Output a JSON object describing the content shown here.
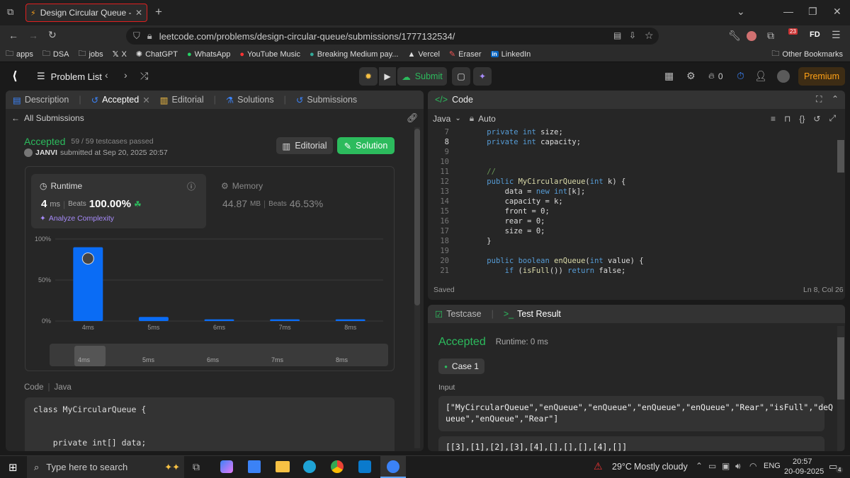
{
  "browser": {
    "tab_title": "Design Circular Queue - LeetCo",
    "url": "leetcode.com/problems/design-circular-queue/submissions/1777132534/",
    "bookmarks": [
      "apps",
      "DSA",
      "jobs",
      "X",
      "ChatGPT",
      "WhatsApp",
      "YouTube Music",
      "Breaking Medium pay...",
      "Vercel",
      "Eraser",
      "LinkedIn"
    ],
    "other_bookmarks": "Other Bookmarks",
    "ext_badge": "23",
    "profile": "FD"
  },
  "header": {
    "problem_list": "Problem List",
    "submit": "Submit",
    "streak": "0",
    "premium": "Premium"
  },
  "left_tabs": {
    "description": "Description",
    "accepted": "Accepted",
    "editorial": "Editorial",
    "solutions": "Solutions",
    "submissions": "Submissions"
  },
  "submission": {
    "back": "All Submissions",
    "status": "Accepted",
    "passed": "59 / 59 testcases passed",
    "user": "JANVI",
    "submitted": "submitted at Sep 20, 2025 20:57",
    "editorial_btn": "Editorial",
    "solution_btn": "Solution",
    "runtime_label": "Runtime",
    "runtime_value": "4",
    "runtime_unit": "ms",
    "beats": "Beats",
    "runtime_beats": "100.00%",
    "analyze": "Analyze Complexity",
    "memory_label": "Memory",
    "memory_value": "44.87",
    "memory_unit": "MB",
    "memory_beats": "46.53%",
    "code_label": "Code",
    "code_lang": "Java"
  },
  "chart_data": {
    "type": "bar",
    "categories": [
      "4ms",
      "5ms",
      "6ms",
      "7ms",
      "8ms"
    ],
    "values": [
      90,
      5,
      2,
      2,
      2
    ],
    "yticks": [
      "100%",
      "50%",
      "0%"
    ],
    "ylim": [
      0,
      100
    ],
    "color": "#0a6cf5"
  },
  "mini_labels": [
    "4ms",
    "5ms",
    "6ms",
    "7ms",
    "8ms"
  ],
  "submitted_code": [
    "class MyCircularQueue {",
    "",
    "",
    "    private int[] data;"
  ],
  "editor": {
    "title": "Code",
    "lang": "Java",
    "mode": "Auto",
    "status_left": "Saved",
    "status_right": "Ln 8, Col 26",
    "lines": [
      {
        "n": "7",
        "t": "    private int size;"
      },
      {
        "n": "8",
        "t": "    private int capacity;"
      },
      {
        "n": "9",
        "t": ""
      },
      {
        "n": "10",
        "t": ""
      },
      {
        "n": "11",
        "t": "    //"
      },
      {
        "n": "12",
        "t": "    public MyCircularQueue(int k) {"
      },
      {
        "n": "13",
        "t": "        data = new int[k];"
      },
      {
        "n": "14",
        "t": "        capacity = k;"
      },
      {
        "n": "15",
        "t": "        front = 0;"
      },
      {
        "n": "16",
        "t": "        rear = 0;"
      },
      {
        "n": "17",
        "t": "        size = 0;"
      },
      {
        "n": "18",
        "t": "    }"
      },
      {
        "n": "19",
        "t": ""
      },
      {
        "n": "20",
        "t": "    public boolean enQueue(int value) {"
      },
      {
        "n": "21",
        "t": "        if (isFull()) return false;"
      }
    ]
  },
  "result": {
    "testcase_tab": "Testcase",
    "result_tab": "Test Result",
    "status": "Accepted",
    "runtime": "Runtime: 0 ms",
    "case": "Case 1",
    "input_label": "Input",
    "input_1": "[\"MyCircularQueue\",\"enQueue\",\"enQueue\",\"enQueue\",\"enQueue\",\"Rear\",\"isFull\",\"deQ",
    "input_2": "ueue\",\"enQueue\",\"Rear\"]",
    "input_3": "[[3],[1],[2],[3],[4],[],[],[],[4],[]]"
  },
  "taskbar": {
    "search": "Type here to search",
    "temp": "29°C",
    "weather": "Mostly cloudy",
    "lang": "ENG",
    "time": "20:57",
    "date": "20-09-2025",
    "notif": "4"
  }
}
